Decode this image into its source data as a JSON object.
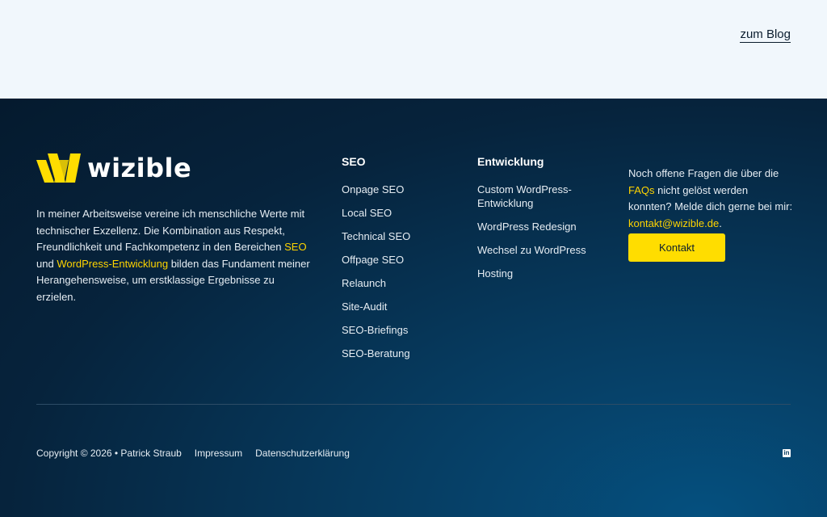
{
  "header": {
    "blog_link": "zum Blog"
  },
  "footer": {
    "logo_text": "wizible",
    "about": {
      "text_1": "In meiner Arbeitsweise vereine ich menschliche Werte mit technischer Exzellenz. Die Kombination aus Respekt, Freundlichkeit und Fachkompetenz in den Bereichen ",
      "link_seo": "SEO",
      "text_2": " und ",
      "link_wp": "WordPress-Entwicklung",
      "text_3": " bilden das Fundament meiner Herangehensweise, um erstklassige Ergebnisse zu erzielen."
    },
    "seo_column": {
      "title": "SEO",
      "items": [
        "Onpage SEO",
        "Local SEO",
        "Technical SEO",
        "Offpage SEO",
        "Relaunch",
        "Site-Audit",
        "SEO-Briefings",
        "SEO-Beratung"
      ]
    },
    "dev_column": {
      "title": "Entwicklung",
      "items": [
        "Custom WordPress-Entwicklung",
        "WordPress Redesign",
        "Wechsel zu WordPress",
        "Hosting"
      ]
    },
    "contact": {
      "text_1": "Noch offene Fragen die über die ",
      "link_faqs": "FAQs",
      "text_2": " nicht gelöst werden konnten? Melde dich gerne bei mir: ",
      "link_email": "kontakt@wizible.de",
      "text_3": ".",
      "button_label": "Kontakt"
    },
    "bottom": {
      "copyright": "Copyright © 2026 • Patrick Straub",
      "impressum": "Impressum",
      "datenschutz": "Datenschutzerklärung",
      "linkedin_icon": "linkedin-icon"
    }
  },
  "colors": {
    "accent": "#ffdd00",
    "footer_bg": "#063a5e",
    "top_bg": "#f1f7fc"
  }
}
